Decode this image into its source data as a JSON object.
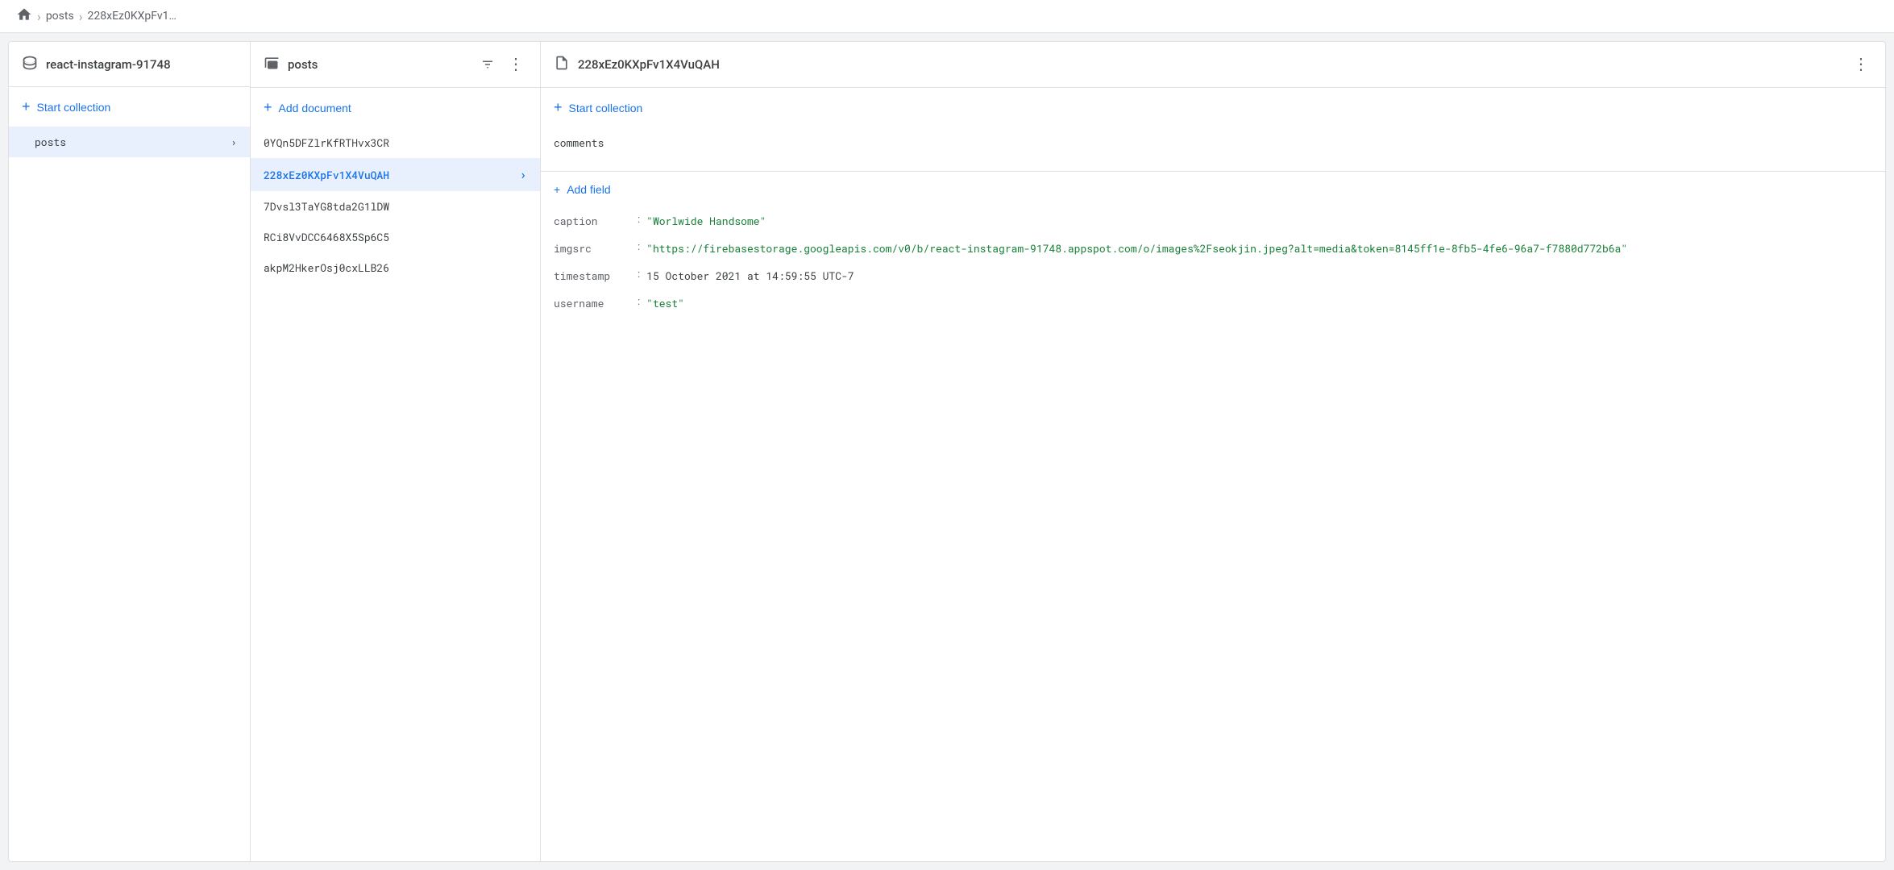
{
  "breadcrumb": {
    "home_label": "Home",
    "items": [
      "posts",
      "228xEz0KXpFv1…"
    ]
  },
  "left_panel": {
    "header": {
      "icon": "database-icon",
      "title": "react-instagram-91748"
    },
    "start_collection_label": "Start collection",
    "collections": [
      {
        "id": "posts",
        "label": "posts"
      }
    ]
  },
  "middle_panel": {
    "header": {
      "icon": "collection-icon",
      "title": "posts"
    },
    "add_document_label": "Add document",
    "documents": [
      {
        "id": "0YQn5DFZlrKfRTHvx3CR",
        "label": "0YQn5DFZlrKfRTHvx3CR",
        "selected": false
      },
      {
        "id": "228xEz0KXpFv1X4VuQAH",
        "label": "228xEz0KXpFv1X4VuQAH",
        "selected": true
      },
      {
        "id": "7Dvsl3TaYG8tda2G1lDW",
        "label": "7Dvsl3TaYG8tda2G1lDW",
        "selected": false
      },
      {
        "id": "RCi8VvDCC6468X5Sp6C5",
        "label": "RCi8VvDCC6468X5Sp6C5",
        "selected": false
      },
      {
        "id": "akpM2HkerOsj0cxLLB26",
        "label": "akpM2HkerOsj0cxLLB26",
        "selected": false
      }
    ]
  },
  "right_panel": {
    "header": {
      "icon": "document-icon",
      "title": "228xEz0KXpFv1X4VuQAH"
    },
    "start_collection_label": "Start collection",
    "subcollections": [
      {
        "id": "comments",
        "label": "comments"
      }
    ],
    "add_field_label": "Add field",
    "fields": [
      {
        "key": "caption",
        "colon": ":",
        "value": "\"Worlwide Handsome\""
      },
      {
        "key": "imgsrc",
        "colon": ":",
        "value": "\"https://firebasestorage.googleapis.com/v0/b/react-instagram-91748.appspot.com/o/images%2Fseokjin.jpeg?alt=media&token=8145ff1e-8fb5-4fe6-96a7-f7880d772b6a\""
      },
      {
        "key": "timestamp",
        "colon": ":",
        "value": "15 October 2021 at 14:59:55 UTC-7"
      },
      {
        "key": "username",
        "colon": ":",
        "value": "\"test\""
      }
    ]
  },
  "icons": {
    "plus": "+",
    "chevron_right": "›",
    "three_dots": "⋮",
    "filter": "≡",
    "home": "⌂"
  }
}
